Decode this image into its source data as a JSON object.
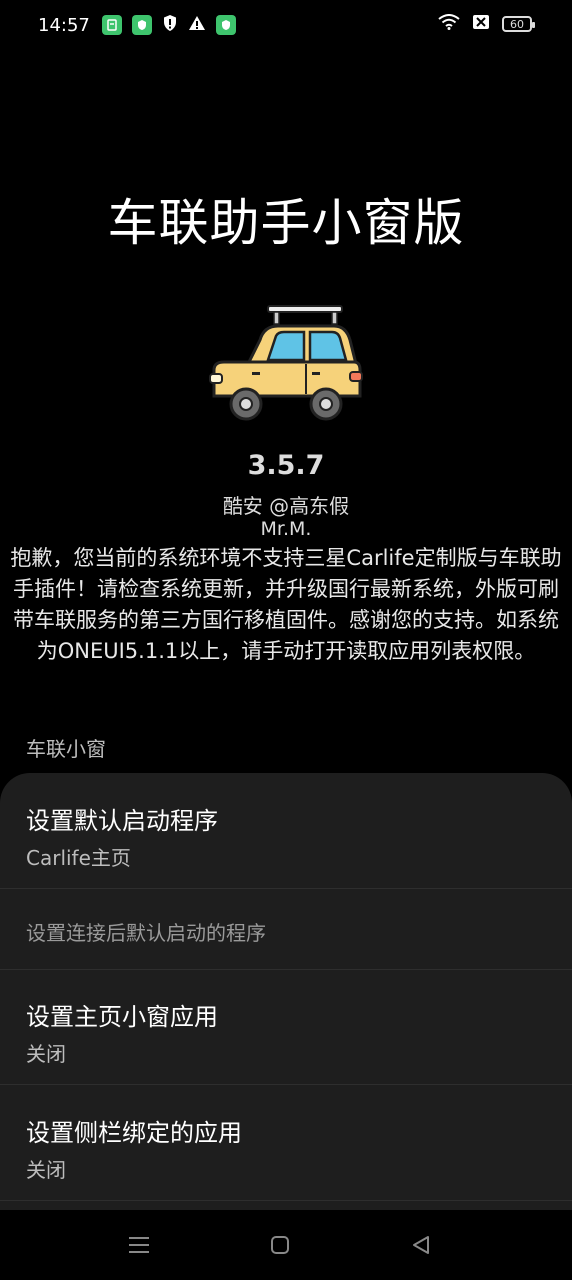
{
  "status_bar": {
    "time": "14:57",
    "battery": "60",
    "icons_left": [
      "app-notification-icon",
      "shield-icon",
      "shield-outline-icon",
      "warning-icon",
      "shield-icon"
    ],
    "icons_right": [
      "wifi-icon",
      "no-sim-icon",
      "battery-icon"
    ]
  },
  "app": {
    "title": "车联助手小窗版",
    "logo_icon": "car-icon",
    "version": "3.5.7",
    "author": "酷安 @高东假",
    "author2": "Mr.M.",
    "notice": "抱歉，您当前的系统环境不支持三星Carlife定制版与车联助手插件！请检查系统更新，并升级国行最新系统，外版可刷带车联服务的第三方国行移植固件。感谢您的支持。如系统为ONEUI5.1.1以上，请手动打开读取应用列表权限。"
  },
  "section": {
    "header": "车联小窗",
    "items": [
      {
        "title": "设置默认启动程序",
        "value": "Carlife主页"
      },
      {
        "hint": "设置连接后默认启动的程序"
      },
      {
        "title": "设置主页小窗应用",
        "value": "关闭"
      },
      {
        "title": "设置侧栏绑定的应用",
        "value": "关闭"
      }
    ]
  },
  "nav": {
    "icons": [
      "menu-icon",
      "home-icon",
      "back-icon"
    ]
  },
  "colors": {
    "background": "#000000",
    "card": "#1e1e1e",
    "car_body": "#f6d27a",
    "car_window": "#5fc3e6",
    "status_green": "#3ec46d"
  }
}
